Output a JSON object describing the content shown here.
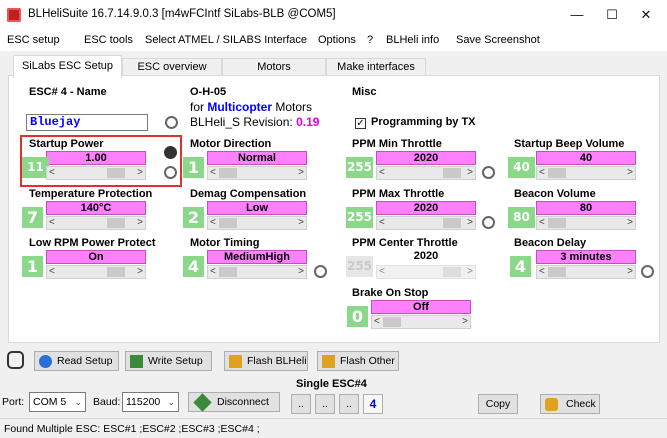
{
  "window": {
    "title": "BLHeliSuite 16.7.14.9.0.3  [m4wFCIntf SiLabs-BLB @COM5]",
    "minimize": "—",
    "maximize": "☐",
    "close": "✕"
  },
  "menu": [
    "ESC setup",
    "ESC tools",
    "Select ATMEL / SILABS Interface",
    "Options",
    "?",
    "BLHeli info",
    "Save Screenshot"
  ],
  "tabs": [
    "SiLabs ESC Setup",
    "ESC overview",
    "Motors",
    "Make interfaces"
  ],
  "esc": {
    "name_title": "ESC# 4 - Name",
    "name_value": "Bluejay",
    "model": "O-H-05",
    "for_text": "for",
    "multicopter": "Multicopter",
    "motors_text": "Motors",
    "revision_label": "BLHeli_S Revision:",
    "revision_value": "0.19",
    "misc_title": "Misc",
    "programming_by_tx": "Programming by TX",
    "programming_by_tx_checked": true
  },
  "params": {
    "startup_power": {
      "label": "Startup Power",
      "value": "1.00",
      "num": "11",
      "level": 0.85
    },
    "temp_protection": {
      "label": "Temperature Protection",
      "value": "140°C",
      "num": "7",
      "level": 0.85
    },
    "low_rpm": {
      "label": "Low RPM Power Protect",
      "value": "On",
      "num": "1",
      "level": 0.85
    },
    "motor_direction": {
      "label": "Motor Direction",
      "value": "Normal",
      "num": "1",
      "level": 0.0
    },
    "demag": {
      "label": "Demag Compensation",
      "value": "Low",
      "num": "2",
      "level": 0.0
    },
    "motor_timing": {
      "label": "Motor Timing",
      "value": "MediumHigh",
      "num": "4",
      "level": 0.0
    },
    "ppm_min": {
      "label": "PPM Min Throttle",
      "value": "2020",
      "num": "255",
      "level": 0.95
    },
    "ppm_max": {
      "label": "PPM Max Throttle",
      "value": "2020",
      "num": "255",
      "level": 0.95
    },
    "ppm_center": {
      "label": "PPM Center Throttle",
      "value": "2020",
      "num": "255",
      "level": 0.95,
      "disabled": true
    },
    "brake_on_stop": {
      "label": "Brake On Stop",
      "value": "Off",
      "num": "0",
      "level": 0.0
    },
    "startup_beep": {
      "label": "Startup Beep Volume",
      "value": "40",
      "num": "40",
      "level": 0.0
    },
    "beacon_volume": {
      "label": "Beacon Volume",
      "value": "80",
      "num": "80",
      "level": 0.0
    },
    "beacon_delay": {
      "label": "Beacon Delay",
      "value": "3 minutes",
      "num": "4",
      "level": 0.0
    }
  },
  "buttons": {
    "read_setup": "Read Setup",
    "write_setup": "Write Setup",
    "flash_blheli": "Flash BLHeli",
    "flash_other": "Flash Other",
    "disconnect": "Disconnect",
    "copy": "Copy",
    "check": "Check"
  },
  "connection": {
    "port_label": "Port:",
    "port_value": "COM 5",
    "baud_label": "Baud:",
    "baud_value": "115200",
    "single_esc": "Single ESC#4",
    "esc_btn": "..",
    "esc_num": "4"
  },
  "status": "Found Multiple ESC: ESC#1 ;ESC#2 ;ESC#3 ;ESC#4 ;",
  "colors": {
    "value_pink": "#ff80ff",
    "num_green": "#8bd88b",
    "highlight_red": "#e03030",
    "name_blue": "#0000ff",
    "revision_magenta": "#e000e0"
  }
}
